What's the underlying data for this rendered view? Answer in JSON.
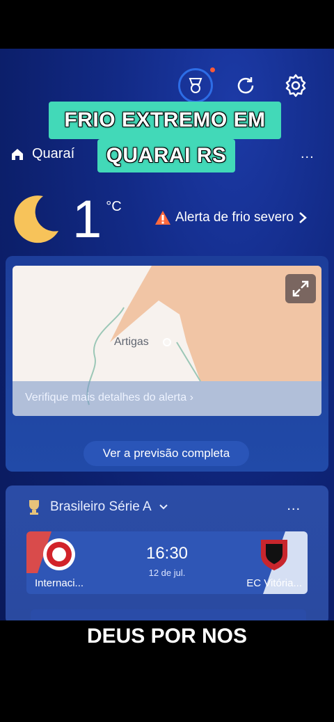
{
  "overlay": {
    "line1": "FRIO  EXTREMO EM",
    "line2": "QUARAI RS"
  },
  "header": {
    "icons": [
      "rewards-icon",
      "refresh-icon",
      "gear-icon"
    ]
  },
  "location": {
    "name": "Quaraí",
    "more": "..."
  },
  "weather": {
    "temperature": "1",
    "unit": "°C",
    "condition_icon": "moon-icon",
    "alert_text": "Alerta de frio severo",
    "map_city": "Artigas",
    "map_link": "Verifique mais detalhes do alerta",
    "forecast_button": "Ver a previsão completa"
  },
  "sports": {
    "league": "Brasileiro Série A",
    "more": "...",
    "match": {
      "home": "Internaci...",
      "away": "EC Vitória...",
      "time": "16:30",
      "date": "12 de jul."
    }
  },
  "caption": "DEUS POR NOS",
  "colors": {
    "accent": "#42d9b8",
    "screen_bg": "#122a86",
    "alert": "#ff5a36"
  }
}
